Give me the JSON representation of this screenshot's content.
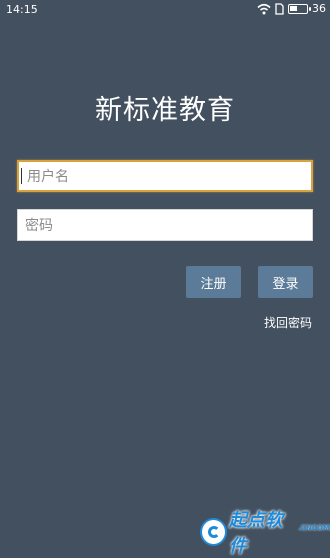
{
  "status_bar": {
    "time": "14:15",
    "battery": "36"
  },
  "app": {
    "title": "新标准教育"
  },
  "form": {
    "username_placeholder": "用户名",
    "password_placeholder": "密码"
  },
  "buttons": {
    "register": "注册",
    "login": "登录"
  },
  "links": {
    "forgot_password": "找回密码"
  },
  "watermark": {
    "text": "起点软件",
    "domain": ".CNCOM"
  },
  "colors": {
    "background": "#43505f",
    "button": "#5b7b99",
    "focus_border": "#d8a33d"
  }
}
